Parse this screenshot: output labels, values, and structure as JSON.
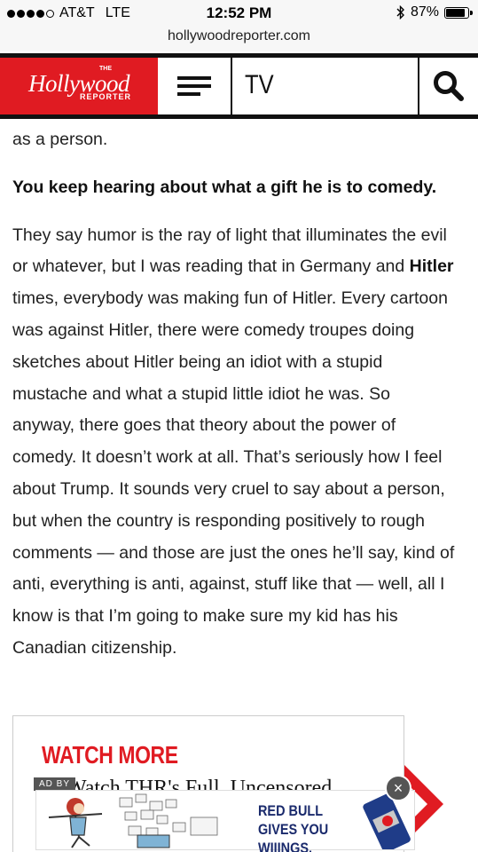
{
  "status_bar": {
    "carrier": "AT&T",
    "network": "LTE",
    "time": "12:52 PM",
    "battery": "87%",
    "battery_level": 0.87
  },
  "browser": {
    "url": "hollywoodreporter.com"
  },
  "header": {
    "logo_main": "Hollywood",
    "logo_top": "THE",
    "logo_sub": "REPORTER",
    "section": "TV"
  },
  "article": {
    "fragment": "as a person.",
    "question": "You keep hearing about what a gift he is to comedy.",
    "answer_part1": "They say humor is the ray of light that illuminates the evil or whatever, but I was reading that in Germany and ",
    "answer_bold": "Hitler",
    "answer_part2": " times, everybody was making fun of Hitler. Every cartoon was against Hitler, there were comedy troupes doing sketches about Hitler being an idiot with a stupid mustache and what a stupid little idiot he was. So anyway, there goes that theory about the power of comedy. It doesn’t work at all. That’s seriously how I feel about Trump. It sounds very cruel to say about a person, but when the country is responding positively to rough comments — and those are just the ones he’ll say, kind of anti, everything is anti, against, stuff like that — well, all I know is that I’m going to make sure my kid has his Canadian citizenship."
  },
  "watch_more": {
    "title": "WATCH MORE",
    "subtitle": "Watch THR's Full, Uncensored"
  },
  "ad": {
    "label": "AD BY",
    "text": "RED BULL GIVES YOU WIIINGS.",
    "close": "×"
  },
  "colors": {
    "brand_red": "#e01b22",
    "ad_navy": "#1a2a6c"
  }
}
